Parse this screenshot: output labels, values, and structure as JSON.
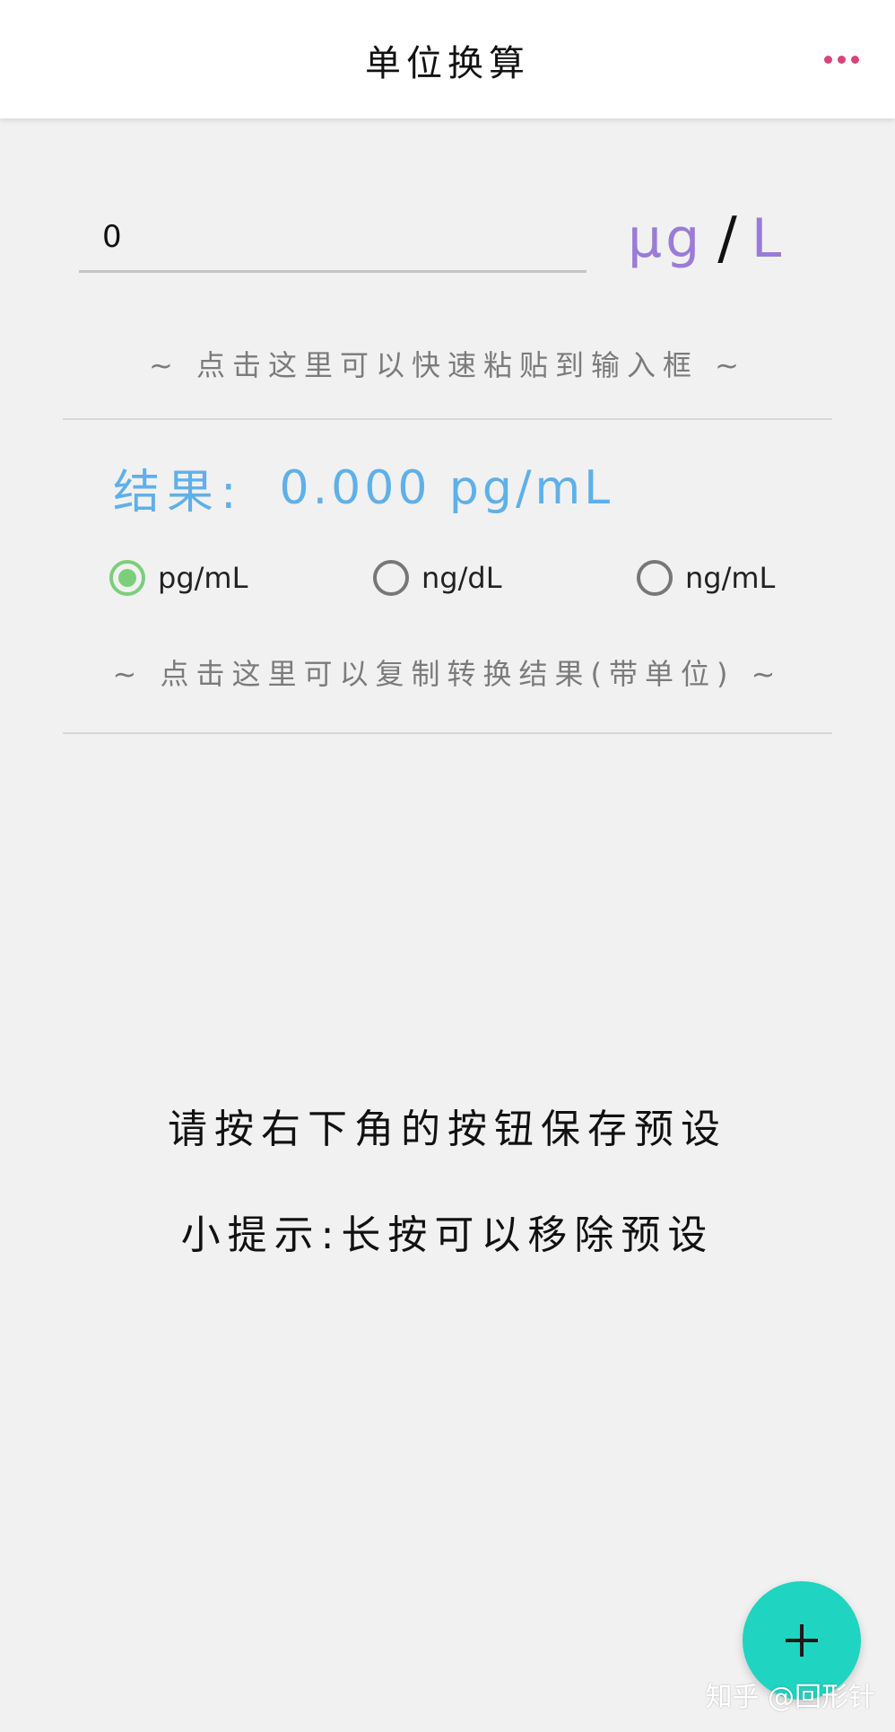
{
  "header": {
    "title": "单位换算",
    "more_icon": "more-horizontal-icon",
    "accent_color": "#d8457a"
  },
  "converter": {
    "input_value": "0",
    "unit": {
      "numerator": "μg",
      "slash": "/",
      "denominator": "L"
    },
    "paste_hint": "~ 点击这里可以快速粘贴到输入框 ~"
  },
  "result": {
    "label": "结果:",
    "value": "0.000 pg/mL",
    "color": "#5fb0e8"
  },
  "target_units": [
    {
      "label": "pg/mL",
      "selected": true
    },
    {
      "label": "ng/dL",
      "selected": false
    },
    {
      "label": "ng/mL",
      "selected": false
    }
  ],
  "copy_hint": "~ 点击这里可以复制转换结果(带单位) ~",
  "presets": {
    "empty_message": "请按右下角的按钮保存预设",
    "tip": "小提示:长按可以移除预设"
  },
  "fab": {
    "icon": "plus-icon",
    "color": "#1fd4c0"
  },
  "watermark": "知乎 @回形针"
}
